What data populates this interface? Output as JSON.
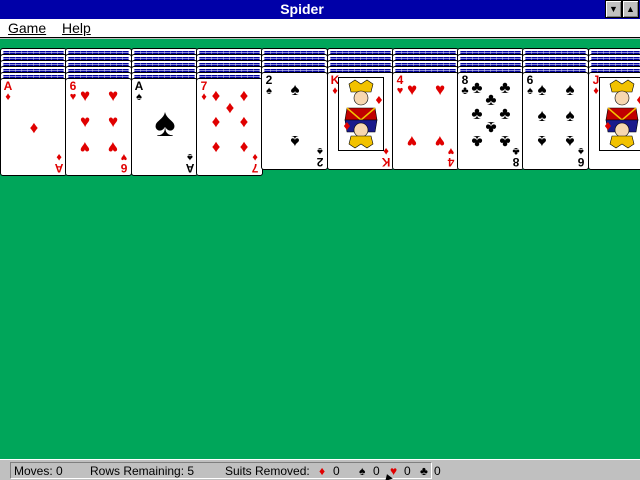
{
  "window": {
    "title": "Spider"
  },
  "titlebar": {
    "minimize_glyph": "▼",
    "maximize_glyph": "▲"
  },
  "menu": {
    "game": "Game",
    "help": "Help"
  },
  "tableau": {
    "piles": [
      {
        "rank": "A",
        "suit": "♦",
        "color": "red",
        "kind": "ace"
      },
      {
        "rank": "6",
        "suit": "♥",
        "color": "red",
        "kind": "six"
      },
      {
        "rank": "A",
        "suit": "♠",
        "color": "black",
        "kind": "ace-spade"
      },
      {
        "rank": "7",
        "suit": "♦",
        "color": "red",
        "kind": "seven"
      },
      {
        "rank": "2",
        "suit": "♠",
        "color": "black",
        "kind": "two"
      },
      {
        "rank": "K",
        "suit": "♦",
        "color": "red",
        "kind": "court"
      },
      {
        "rank": "4",
        "suit": "♥",
        "color": "red",
        "kind": "four"
      },
      {
        "rank": "8",
        "suit": "♣",
        "color": "black",
        "kind": "eight"
      },
      {
        "rank": "6",
        "suit": "♠",
        "color": "black",
        "kind": "six"
      },
      {
        "rank": "J",
        "suit": "♦",
        "color": "red",
        "kind": "court"
      }
    ]
  },
  "status": {
    "moves_label": "Moves: 0",
    "rows_label": "Rows Remaining: 5",
    "suits_label": "Suits Removed:",
    "suits": [
      {
        "icon": "diamond-icon",
        "glyph": "♦",
        "color": "#e00000",
        "count": "0"
      },
      {
        "icon": "spade-icon",
        "glyph": "♠",
        "color": "#000000",
        "count": "0"
      },
      {
        "icon": "heart-icon",
        "glyph": "♥",
        "color": "#e00000",
        "count": "0"
      },
      {
        "icon": "club-icon",
        "glyph": "♣",
        "color": "#000000",
        "count": "0"
      }
    ]
  },
  "colors": {
    "felt": "#00a65a",
    "card_back": "#0000a0",
    "titlebar": "#0000a8",
    "red": "#e00000"
  }
}
